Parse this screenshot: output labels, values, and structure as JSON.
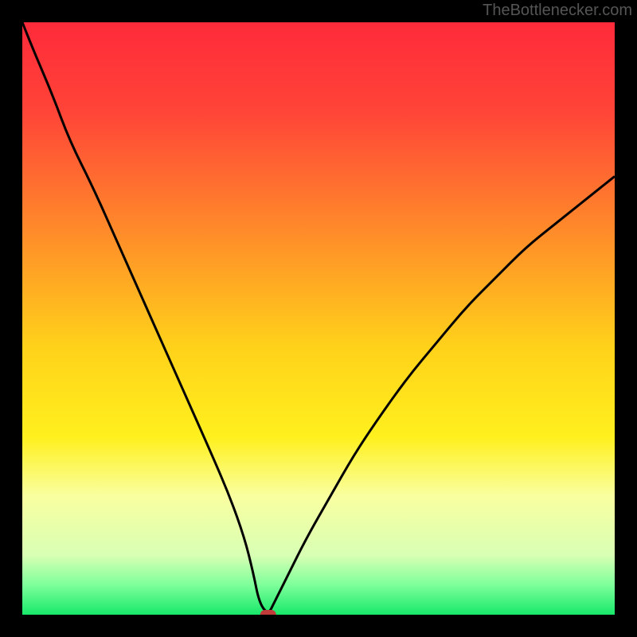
{
  "watermark": "TheBottlenecker.com",
  "chart_data": {
    "type": "line",
    "title": "",
    "xlabel": "",
    "ylabel": "",
    "xlim": [
      0,
      100
    ],
    "ylim": [
      0,
      100
    ],
    "background": {
      "type": "vertical_gradient",
      "stops": [
        {
          "pos": 0.0,
          "color": "#ff2a3a"
        },
        {
          "pos": 0.15,
          "color": "#ff4438"
        },
        {
          "pos": 0.35,
          "color": "#ff8a2a"
        },
        {
          "pos": 0.55,
          "color": "#ffd21a"
        },
        {
          "pos": 0.7,
          "color": "#fff01e"
        },
        {
          "pos": 0.8,
          "color": "#f9ffa0"
        },
        {
          "pos": 0.9,
          "color": "#d8ffb4"
        },
        {
          "pos": 0.95,
          "color": "#7dff9a"
        },
        {
          "pos": 1.0,
          "color": "#17e86a"
        }
      ]
    },
    "series": [
      {
        "name": "bottleneck_curve",
        "color": "#000000",
        "x": [
          0,
          2,
          5,
          8,
          12,
          16,
          20,
          24,
          28,
          32,
          35,
          37.5,
          39,
          40,
          41.5,
          42.5,
          45,
          48,
          52,
          56,
          60,
          65,
          70,
          75,
          80,
          85,
          90,
          95,
          100
        ],
        "y": [
          100,
          95,
          88,
          80,
          72,
          63,
          54,
          45,
          36,
          27,
          20,
          13,
          7,
          2,
          0,
          2,
          7,
          13,
          20,
          27,
          33,
          40,
          46,
          52,
          57,
          62,
          66,
          70,
          74
        ]
      }
    ],
    "marker": {
      "name": "bottleneck_point",
      "x": 41.5,
      "y": 0,
      "color": "#c23b3b",
      "shape": "pill"
    }
  }
}
